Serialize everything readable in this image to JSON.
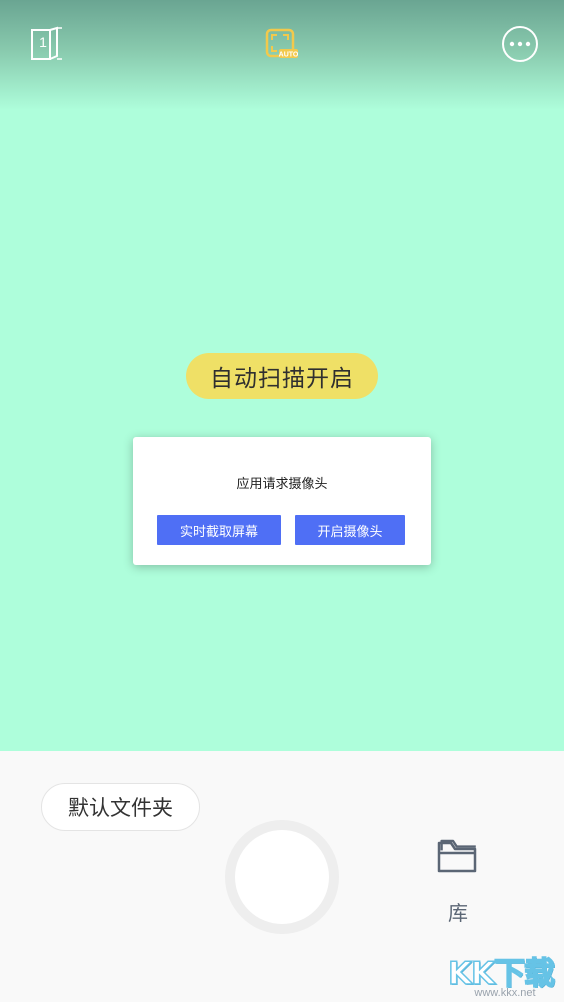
{
  "top_bar": {
    "page_count": "1",
    "auto_scan_icon": "auto-scan-icon",
    "auto_scan_icon_color": "#f2c94c",
    "more_icon": "more-dots-icon"
  },
  "camera": {
    "auto_scan_status": "自动扫描开启",
    "background_color": "#aefedb"
  },
  "dialog": {
    "message": "应用请求摄像头",
    "screen_capture_label": "实时截取屏幕",
    "open_camera_label": "开启摄像头",
    "button_color": "#4f6ff5"
  },
  "bottom_panel": {
    "folder_label": "默认文件夹",
    "library_label": "库",
    "library_icon": "folder-icon",
    "shutter_icon": "shutter-button"
  },
  "watermark": {
    "logo_text": "KK下载",
    "url": "www.kkx.net"
  }
}
